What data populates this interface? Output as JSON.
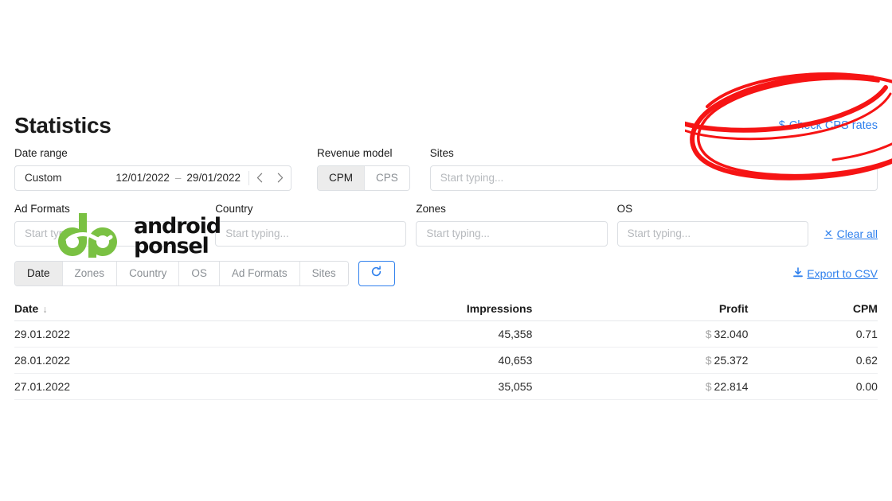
{
  "header": {
    "title": "Statistics",
    "cps_rates_link": "Check CPS rates",
    "cps_rates_icon": "dollar-icon"
  },
  "filters": {
    "date_range": {
      "label": "Date range",
      "preset": "Custom",
      "start": "12/01/2022",
      "end": "29/01/2022",
      "dash": "–",
      "prev_icon": "chevron-left-icon",
      "next_icon": "chevron-right-icon"
    },
    "revenue_model": {
      "label": "Revenue model",
      "options": [
        "CPM",
        "CPS"
      ],
      "selected": "CPM"
    },
    "sites": {
      "label": "Sites",
      "value": "",
      "placeholder": "Start typing..."
    },
    "ad_formats": {
      "label": "Ad Formats",
      "value": "",
      "placeholder": "Start typing..."
    },
    "country": {
      "label": "Country",
      "value": "",
      "placeholder": "Start typing..."
    },
    "zones": {
      "label": "Zones",
      "value": "",
      "placeholder": "Start typing..."
    },
    "os": {
      "label": "OS",
      "value": "",
      "placeholder": "Start typing..."
    },
    "clear_all": "Clear all",
    "clear_all_icon": "close-x-icon"
  },
  "group_tabs": {
    "items": [
      "Date",
      "Zones",
      "Country",
      "OS",
      "Ad Formats",
      "Sites"
    ],
    "selected": "Date",
    "refresh_icon": "refresh-icon"
  },
  "export": {
    "label": "Export to CSV",
    "icon": "download-icon"
  },
  "table": {
    "columns": [
      "Date",
      "Impressions",
      "Profit",
      "CPM"
    ],
    "sort_column": "Date",
    "sort_icon": "arrow-down-icon",
    "currency_symbol": "$",
    "rows": [
      {
        "date": "29.01.2022",
        "impressions": "45,358",
        "profit": "32.040",
        "cpm": "0.71"
      },
      {
        "date": "28.01.2022",
        "impressions": "40,653",
        "profit": "25.372",
        "cpm": "0.62"
      },
      {
        "date": "27.01.2022",
        "impressions": "35,055",
        "profit": "22.814",
        "cpm": "0.00"
      }
    ]
  },
  "watermark": {
    "line1": "android",
    "line2": "ponsel",
    "logo_icon": "dp-monogram-logo",
    "logo_color": "#7ac143"
  },
  "annotation": {
    "type": "hand-drawn-ellipse",
    "color": "#f61414",
    "target": "Check CPS rates"
  },
  "colors": {
    "accent_blue": "#2f80ed",
    "text": "#1b1b1b",
    "border": "#dcdfe3",
    "active_segment": "#ececec"
  }
}
